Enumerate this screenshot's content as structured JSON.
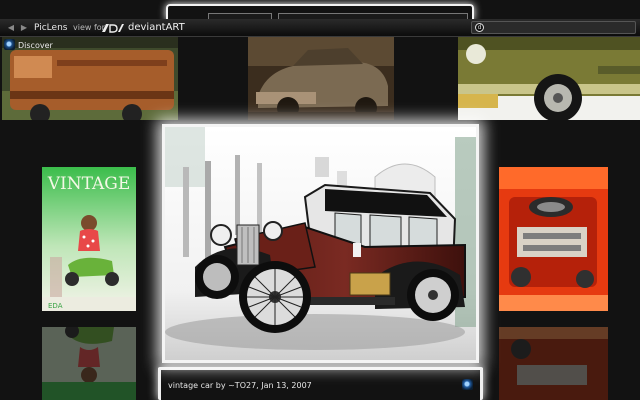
{
  "toolbar": {
    "back_icon": "back-arrow-icon",
    "forward_icon": "forward-arrow-icon",
    "brand": "PicLens",
    "brand_sub": "view for",
    "site": "deviantART",
    "search": {
      "value": "",
      "placeholder": ""
    }
  },
  "sidebar": {
    "discover_label": "Discover"
  },
  "thumbnails": [
    {
      "name": "rusty-truck"
    },
    {
      "name": "sepia-sedan"
    },
    {
      "name": "green-pickup-wheel"
    },
    {
      "name": "vintage-scooter-poster"
    },
    {
      "name": "engine-bay"
    },
    {
      "name": "poster-reflection"
    },
    {
      "name": "engine-reflection"
    }
  ],
  "vintage_poster_text": "VINTAGE",
  "vintage_poster_footer": "EDA",
  "selected": {
    "caption": "vintage car by ~TO27, Jan 13, 2007"
  }
}
